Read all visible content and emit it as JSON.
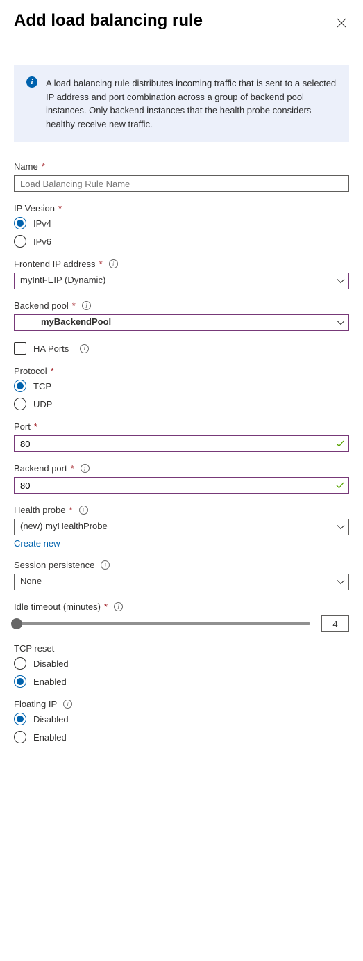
{
  "header": {
    "title": "Add load balancing rule"
  },
  "infoBox": {
    "text": "A load balancing rule distributes incoming traffic that is sent to a selected IP address and port combination across a group of backend pool instances. Only backend instances that the health probe considers healthy receive new traffic."
  },
  "name": {
    "label": "Name",
    "placeholder": "Load Balancing Rule Name",
    "value": ""
  },
  "ipVersion": {
    "label": "IP Version",
    "selected": "IPv4",
    "options": {
      "ipv4": "IPv4",
      "ipv6": "IPv6"
    }
  },
  "frontendIp": {
    "label": "Frontend IP address",
    "value": "myIntFEIP (Dynamic)"
  },
  "backendPool": {
    "label": "Backend pool",
    "value": "myBackendPool"
  },
  "haPorts": {
    "label": "HA Ports",
    "checked": false
  },
  "protocol": {
    "label": "Protocol",
    "selected": "TCP",
    "options": {
      "tcp": "TCP",
      "udp": "UDP"
    }
  },
  "port": {
    "label": "Port",
    "value": "80"
  },
  "backendPort": {
    "label": "Backend port",
    "value": "80"
  },
  "healthProbe": {
    "label": "Health probe",
    "value": "(new) myHealthProbe",
    "createNew": "Create new"
  },
  "sessionPersistence": {
    "label": "Session persistence",
    "value": "None"
  },
  "idleTimeout": {
    "label": "Idle timeout (minutes)",
    "value": "4"
  },
  "tcpReset": {
    "label": "TCP reset",
    "selected": "Enabled",
    "options": {
      "disabled": "Disabled",
      "enabled": "Enabled"
    }
  },
  "floatingIp": {
    "label": "Floating IP",
    "selected": "Disabled",
    "options": {
      "disabled": "Disabled",
      "enabled": "Enabled"
    }
  }
}
